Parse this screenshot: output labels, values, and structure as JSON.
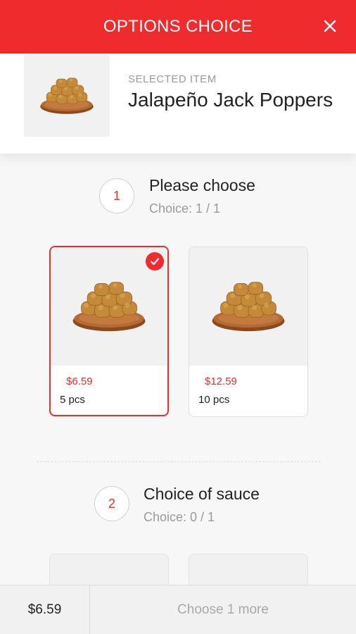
{
  "header": {
    "title": "OPTIONS CHOICE",
    "close_icon": "close-icon"
  },
  "selected": {
    "label": "SELECTED ITEM",
    "name": "Jalapeño Jack Poppers"
  },
  "sections": [
    {
      "number": "1",
      "title": "Please choose",
      "subtitle": "Choice: 1 / 1",
      "options": [
        {
          "price": "$6.59",
          "name": "5 pcs",
          "selected": true
        },
        {
          "price": "$12.59",
          "name": "10 pcs",
          "selected": false
        }
      ]
    },
    {
      "number": "2",
      "title": "Choice of sauce",
      "subtitle": "Choice: 0 / 1"
    }
  ],
  "footer": {
    "total": "$6.59",
    "action": "Choose 1 more"
  },
  "colors": {
    "accent": "#ef2b2d"
  }
}
